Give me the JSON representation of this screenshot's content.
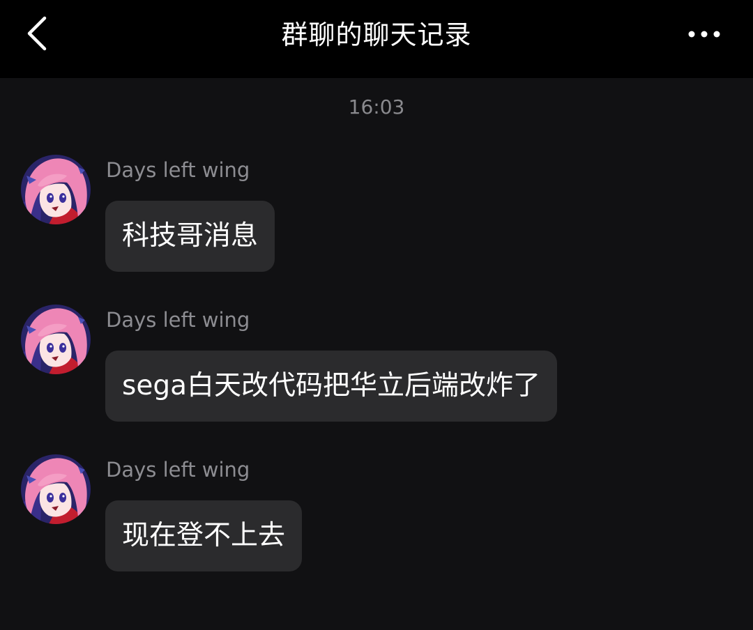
{
  "header": {
    "back_icon": "chevron-left-icon",
    "title": "群聊的聊天记录",
    "more_icon": "more-horizontal-icon"
  },
  "chat": {
    "timestamp": "16:03",
    "messages": [
      {
        "sender": "Days left wing",
        "avatar": "anime-girl-avatar",
        "text": "科技哥消息"
      },
      {
        "sender": "Days left wing",
        "avatar": "anime-girl-avatar",
        "text": "sega白天改代码把华立后端改炸了"
      },
      {
        "sender": "Days left wing",
        "avatar": "anime-girl-avatar",
        "text": "现在登不上去"
      }
    ]
  },
  "colors": {
    "header_bg": "#000000",
    "chat_bg": "#111113",
    "bubble_bg": "#2b2b2d",
    "text_primary": "#ffffff",
    "text_secondary": "#8d8d92",
    "avatar_hair": "#ee86b6",
    "avatar_bg": "#2a2468",
    "avatar_accent": "#c21d2e"
  }
}
